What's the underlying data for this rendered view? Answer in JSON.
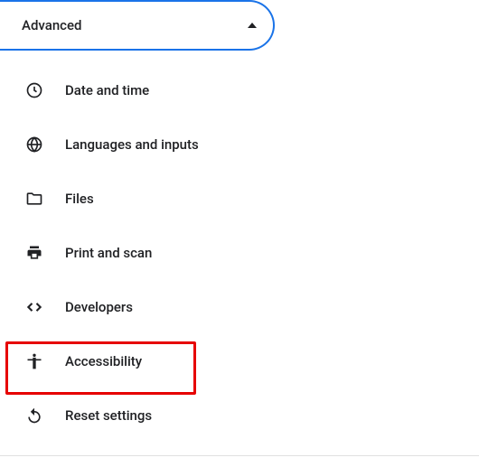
{
  "section": {
    "label": "Advanced",
    "expanded": true
  },
  "menu": {
    "items": [
      {
        "icon": "clock-icon",
        "label": "Date and time"
      },
      {
        "icon": "globe-icon",
        "label": "Languages and inputs"
      },
      {
        "icon": "folder-icon",
        "label": "Files"
      },
      {
        "icon": "printer-icon",
        "label": "Print and scan"
      },
      {
        "icon": "code-icon",
        "label": "Developers"
      },
      {
        "icon": "accessibility-icon",
        "label": "Accessibility"
      },
      {
        "icon": "reset-icon",
        "label": "Reset settings"
      }
    ]
  },
  "highlight_index": 5
}
